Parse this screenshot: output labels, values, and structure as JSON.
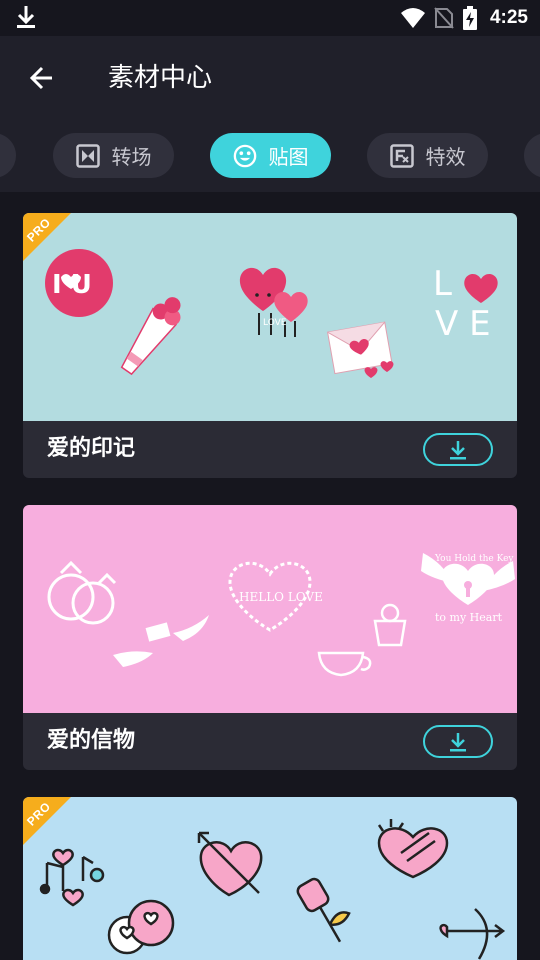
{
  "status_bar": {
    "time": "4:25",
    "icons": [
      "download-icon",
      "wifi-icon",
      "no-sim-icon",
      "battery-charging-icon"
    ]
  },
  "app_bar": {
    "title": "素材中心",
    "back_icon": "arrow-left-icon"
  },
  "tabs": [
    {
      "label": "转场",
      "icon": "transition-icon",
      "active": false
    },
    {
      "label": "贴图",
      "icon": "smiley-icon",
      "active": true
    },
    {
      "label": "特效",
      "icon": "effect-icon",
      "active": false
    }
  ],
  "cards": [
    {
      "name": "爱的印记",
      "pro": true,
      "badge": "PRO",
      "thumb_color": "#b3dce0",
      "thumb_text": {
        "i_u": "I U",
        "love_l": "L",
        "love_ve": "V E",
        "heart_label": "LOVE"
      }
    },
    {
      "name": "爱的信物",
      "pro": false,
      "badge": "",
      "thumb_color": "#f7aede",
      "thumb_text": {
        "hello_love": "HELLO LOVE",
        "script_top": "You Hold the Key",
        "script_bottom": "to my Heart"
      }
    },
    {
      "name": "",
      "pro": true,
      "badge": "PRO",
      "thumb_color": "#b8dff3",
      "thumb_text": {}
    }
  ],
  "colors": {
    "accent": "#3fd3dc",
    "pro_badge": "#f6ad1c",
    "background": "#16161e",
    "bar": "#20202a",
    "card": "#2b2b35"
  }
}
